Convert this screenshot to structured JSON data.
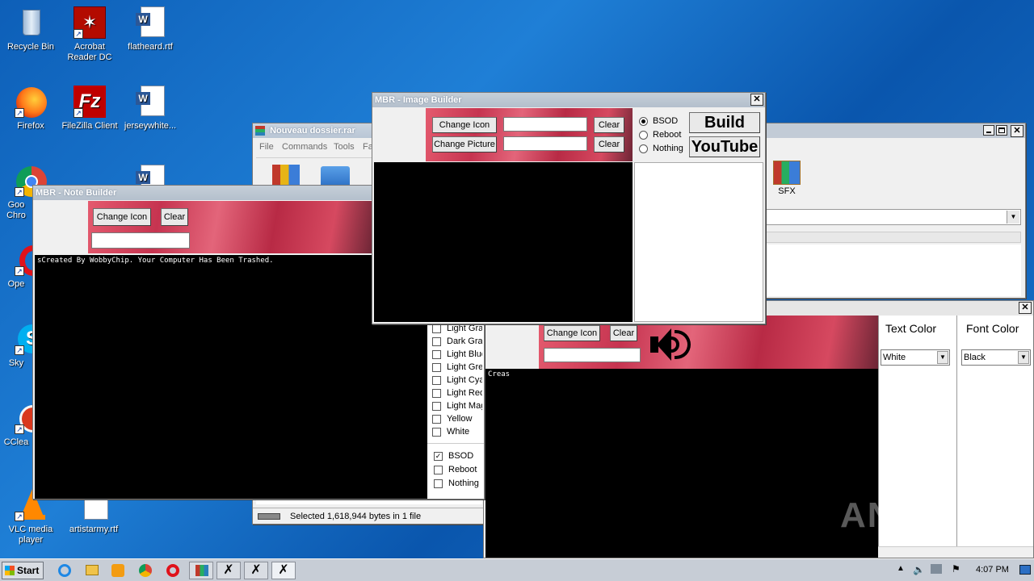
{
  "desktop": {
    "icons": [
      {
        "label": "Recycle Bin",
        "icon": "recycle-bin-icon"
      },
      {
        "label": "Acrobat Reader DC",
        "icon": "acrobat-icon"
      },
      {
        "label": "flatheard.rtf",
        "icon": "word-document-icon"
      },
      {
        "label": "Firefox",
        "icon": "firefox-icon"
      },
      {
        "label": "FileZilla Client",
        "icon": "filezilla-icon"
      },
      {
        "label": "jerseywhite...",
        "icon": "word-document-icon"
      },
      {
        "label": "Goo Chro",
        "icon": "chrome-icon"
      },
      {
        "label": "Ope",
        "icon": "opera-icon"
      },
      {
        "label": "Sky",
        "icon": "skype-icon"
      },
      {
        "label": "CClea",
        "icon": "ccleaner-icon"
      },
      {
        "label": "VLC media player",
        "icon": "vlc-icon"
      },
      {
        "label": "artistarmy.rtf",
        "icon": "word-document-icon"
      }
    ]
  },
  "winrar": {
    "title": "Nouveau dossier.rar",
    "menu": [
      "File",
      "Commands",
      "Tools",
      "Fa"
    ],
    "sfx_label": "SFX",
    "status": "Selected 1,618,944 bytes in 1 file"
  },
  "image_builder": {
    "title": "MBR - Image Builder",
    "change_icon": "Change Icon",
    "change_picture": "Change Picture",
    "clear": "Clear",
    "options": [
      "BSOD",
      "Reboot",
      "Nothing"
    ],
    "selected": "BSOD",
    "build": "Build",
    "youtube": "YouTube"
  },
  "note_builder": {
    "title": "MBR - Note Builder",
    "change_icon": "Change Icon",
    "clear": "Clear",
    "note_text": "sCreated By WobbyChip. Your Computer Has Been Trashed.",
    "colors": [
      "Light Gray",
      "Dark Gray",
      "Light Blue",
      "Light Green",
      "Light Cyan",
      "Light Red",
      "Light Magenta",
      "Yellow",
      "White"
    ],
    "options": [
      "BSOD",
      "Reboot",
      "Nothing"
    ],
    "bsod_checked": true
  },
  "sound_builder": {
    "change_icon": "Change Icon",
    "clear": "Clear",
    "text": "Creas",
    "text_color_label": "Text Color",
    "font_color_label": "Font Color",
    "text_color_value": "White",
    "font_color_value": "Black"
  },
  "watermark": "ANY RUN",
  "taskbar": {
    "start": "Start",
    "time": "4:07 PM"
  }
}
